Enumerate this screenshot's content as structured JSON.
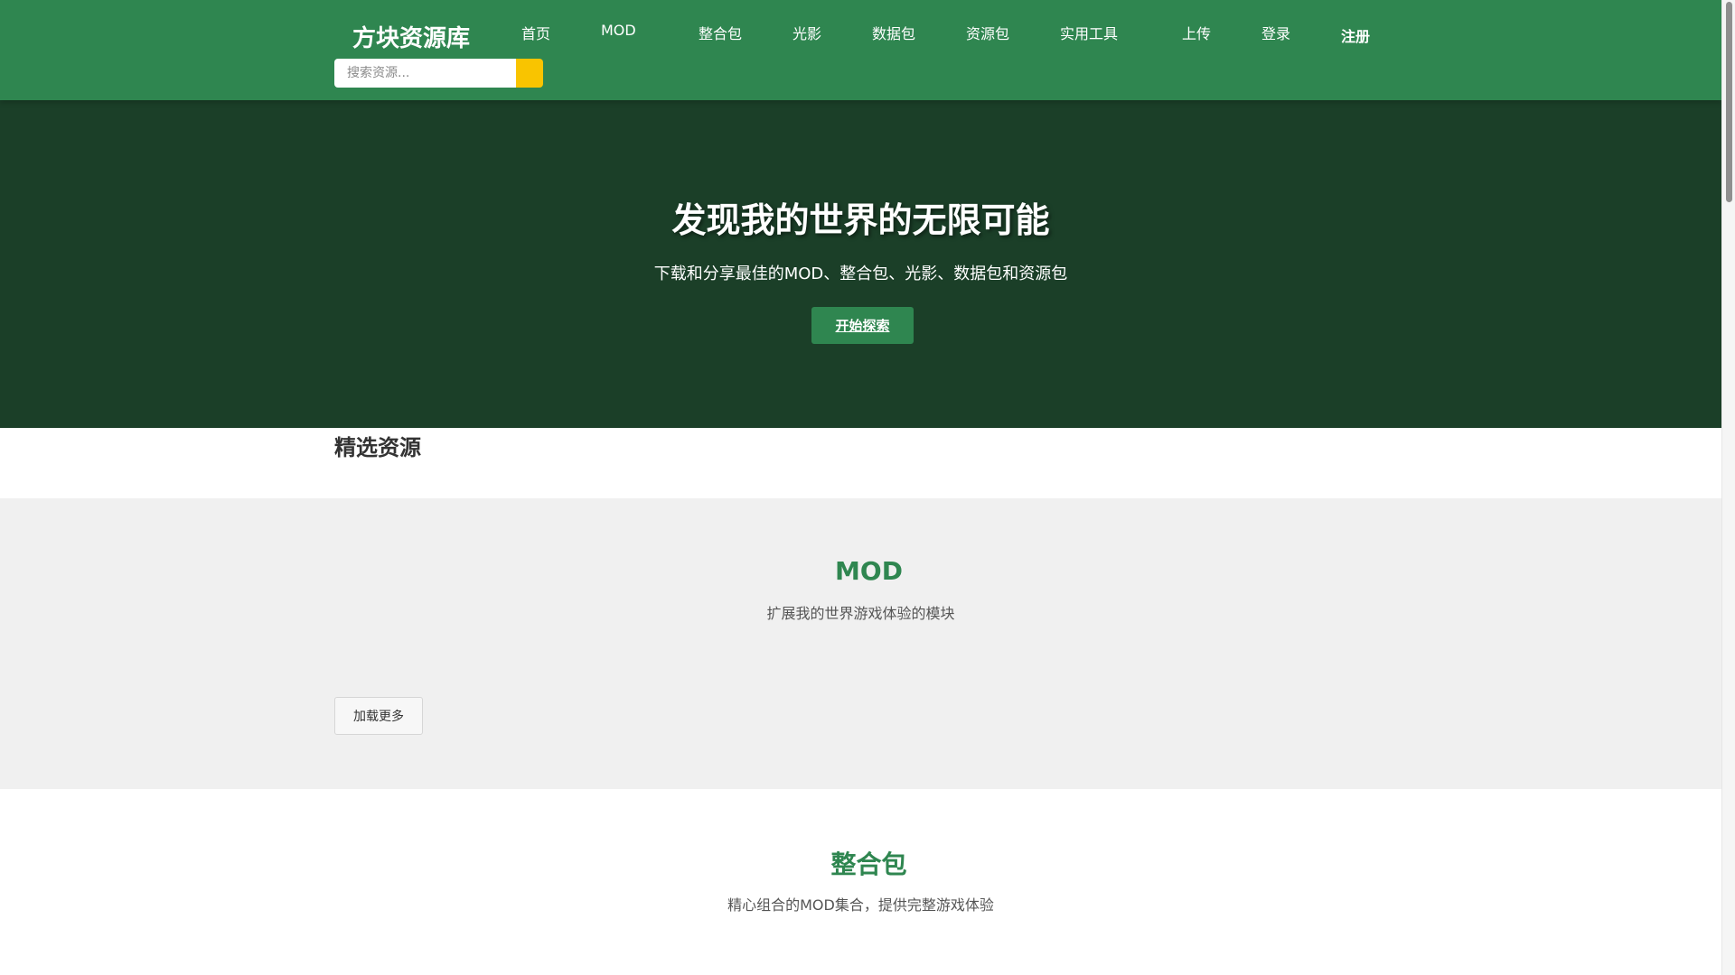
{
  "header": {
    "logo": "方块资源库",
    "nav": [
      "首页",
      "MOD",
      "整合包",
      "光影",
      "数据包",
      "资源包",
      "实用工具",
      "上传",
      "登录",
      "注册"
    ],
    "search_placeholder": "搜索资源...",
    "search_icon": "search-icon"
  },
  "hero": {
    "title": "发现我的世界的无限可能",
    "subtitle": "下载和分享最佳的MOD、整合包、光影、数据包和资源包",
    "cta": "开始探索"
  },
  "featured": {
    "title": "精选资源"
  },
  "sections": {
    "mod": {
      "title": "MOD",
      "desc": "扩展我的世界游戏体验的模块",
      "load_more": "加载更多"
    },
    "modpack": {
      "title": "整合包",
      "desc": "精心组合的MOD集合，提供完整游戏体验"
    }
  },
  "colors": {
    "header_bg": "#2f8650",
    "hero_bg": "#1b3f28",
    "accent": "#2f8650",
    "search_button": "#f9c400",
    "section_alt_bg": "#f0f0f0"
  }
}
